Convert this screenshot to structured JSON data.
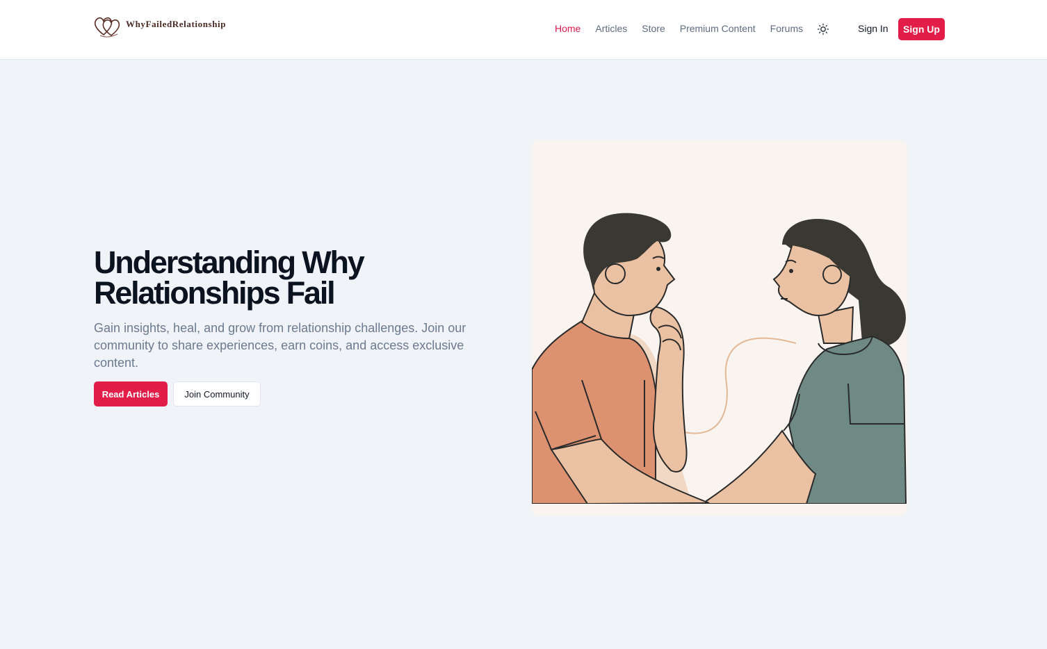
{
  "brand": {
    "name": "WhyFailedRelationship",
    "logo_icon": "double-heart-icon"
  },
  "nav": {
    "links": [
      {
        "label": "Home",
        "active": true
      },
      {
        "label": "Articles",
        "active": false
      },
      {
        "label": "Store",
        "active": false
      },
      {
        "label": "Premium Content",
        "active": false
      },
      {
        "label": "Forums",
        "active": false
      }
    ],
    "theme_icon": "sun-icon",
    "sign_in": "Sign In",
    "sign_up": "Sign Up"
  },
  "hero": {
    "title_line1": "Understanding Why",
    "title_line2": "Relationships Fail",
    "subtitle": "Gain insights, heal, and grow from relationship challenges. Join our community to share experiences, earn coins, and access exclusive content.",
    "primary_button": "Read Articles",
    "secondary_button": "Join Community",
    "illustration": "couple-conversation-illustration"
  },
  "colors": {
    "accent": "#e11d48",
    "page_background": "#f0f3f8",
    "card_background": "#f9f4ef",
    "man_shirt": "#dc9271",
    "woman_shirt": "#6f8a84",
    "skin": "#eac1a2",
    "hair": "#3a3833"
  }
}
